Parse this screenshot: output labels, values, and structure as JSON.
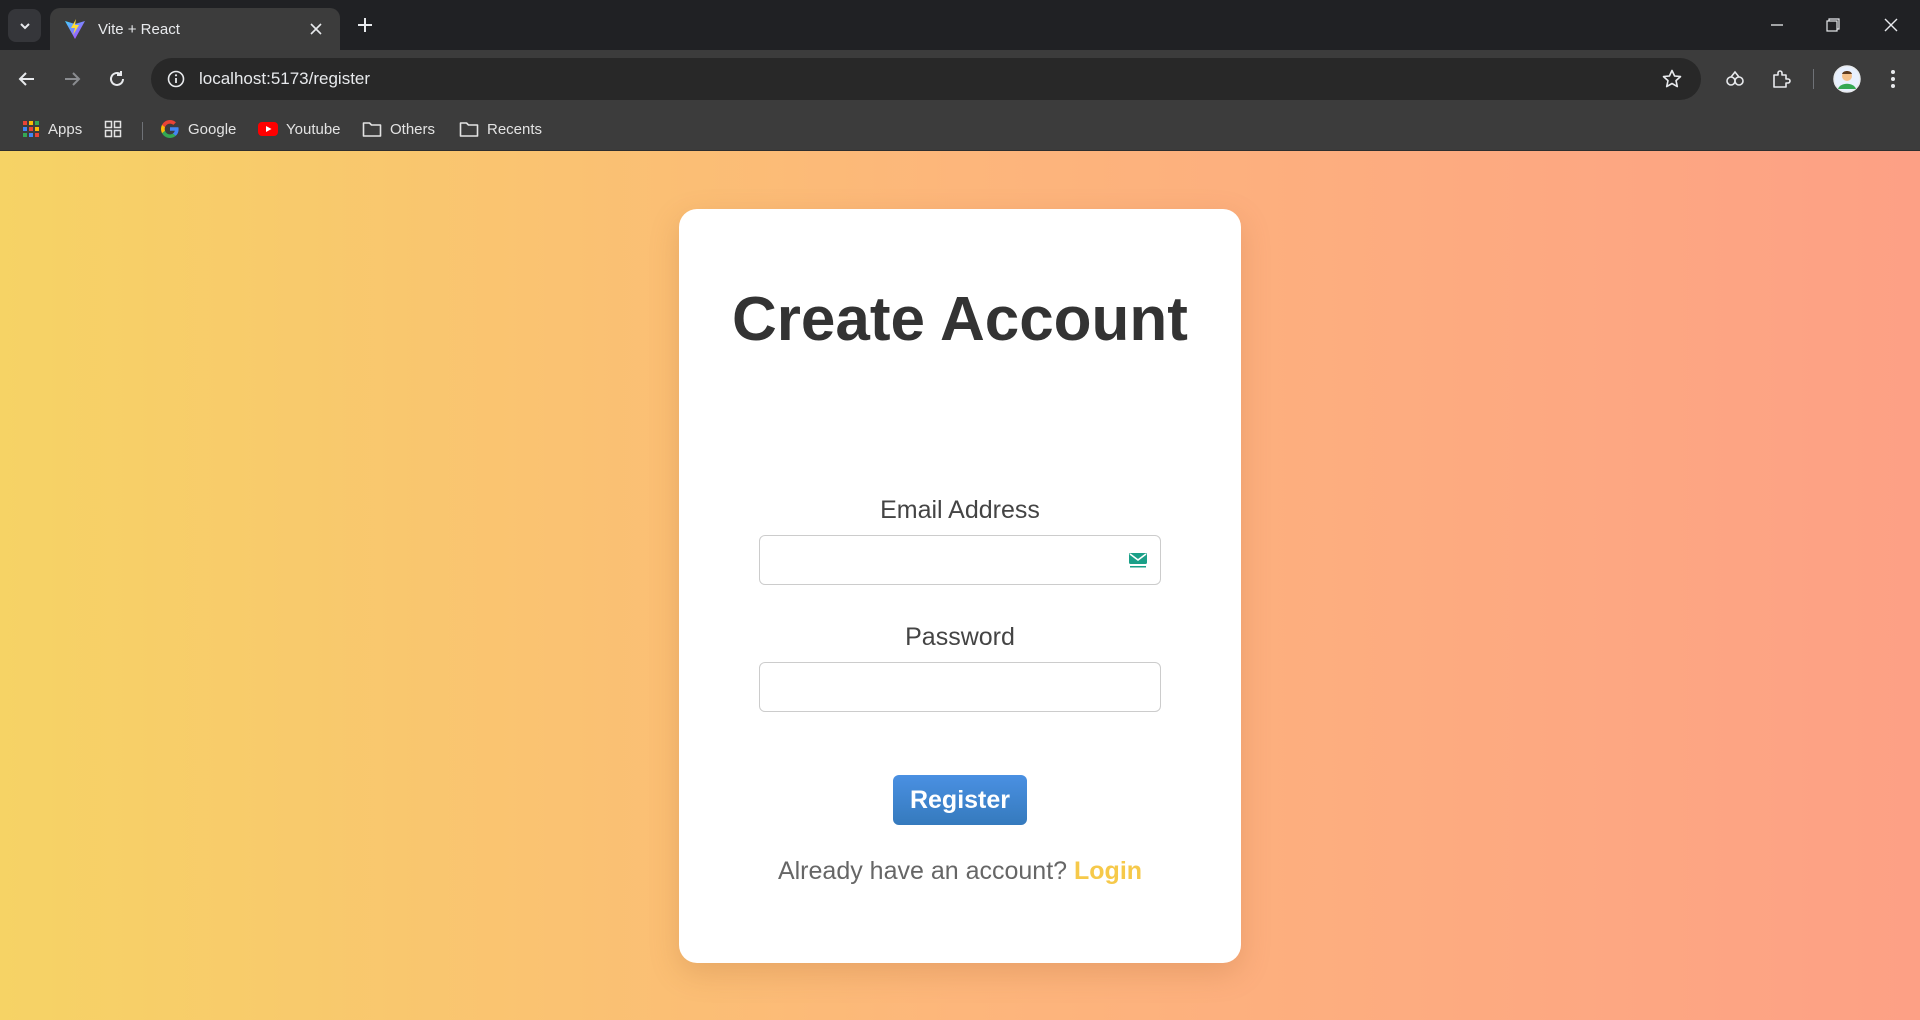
{
  "browser": {
    "tab_title": "Vite + React",
    "url": "localhost:5173/register",
    "bookmarks": [
      {
        "label": "Apps",
        "icon": "apps-grid-icon"
      },
      {
        "label": "",
        "icon": "tab-groups-icon"
      },
      {
        "label": "Google",
        "icon": "google-icon"
      },
      {
        "label": "Youtube",
        "icon": "youtube-icon"
      },
      {
        "label": "Others",
        "icon": "folder-icon"
      },
      {
        "label": "Recents",
        "icon": "folder-icon"
      }
    ]
  },
  "page": {
    "background_colors": [
      "#f6d365",
      "#fda085"
    ],
    "title": "Create Account",
    "email_label": "Email Address",
    "email_value": "",
    "password_label": "Password",
    "password_value": "",
    "register_label": "Register",
    "register_color": "#4a90e2",
    "footer_text": "Already have an account?",
    "login_label": "Login",
    "login_color": "#f6c94a"
  }
}
